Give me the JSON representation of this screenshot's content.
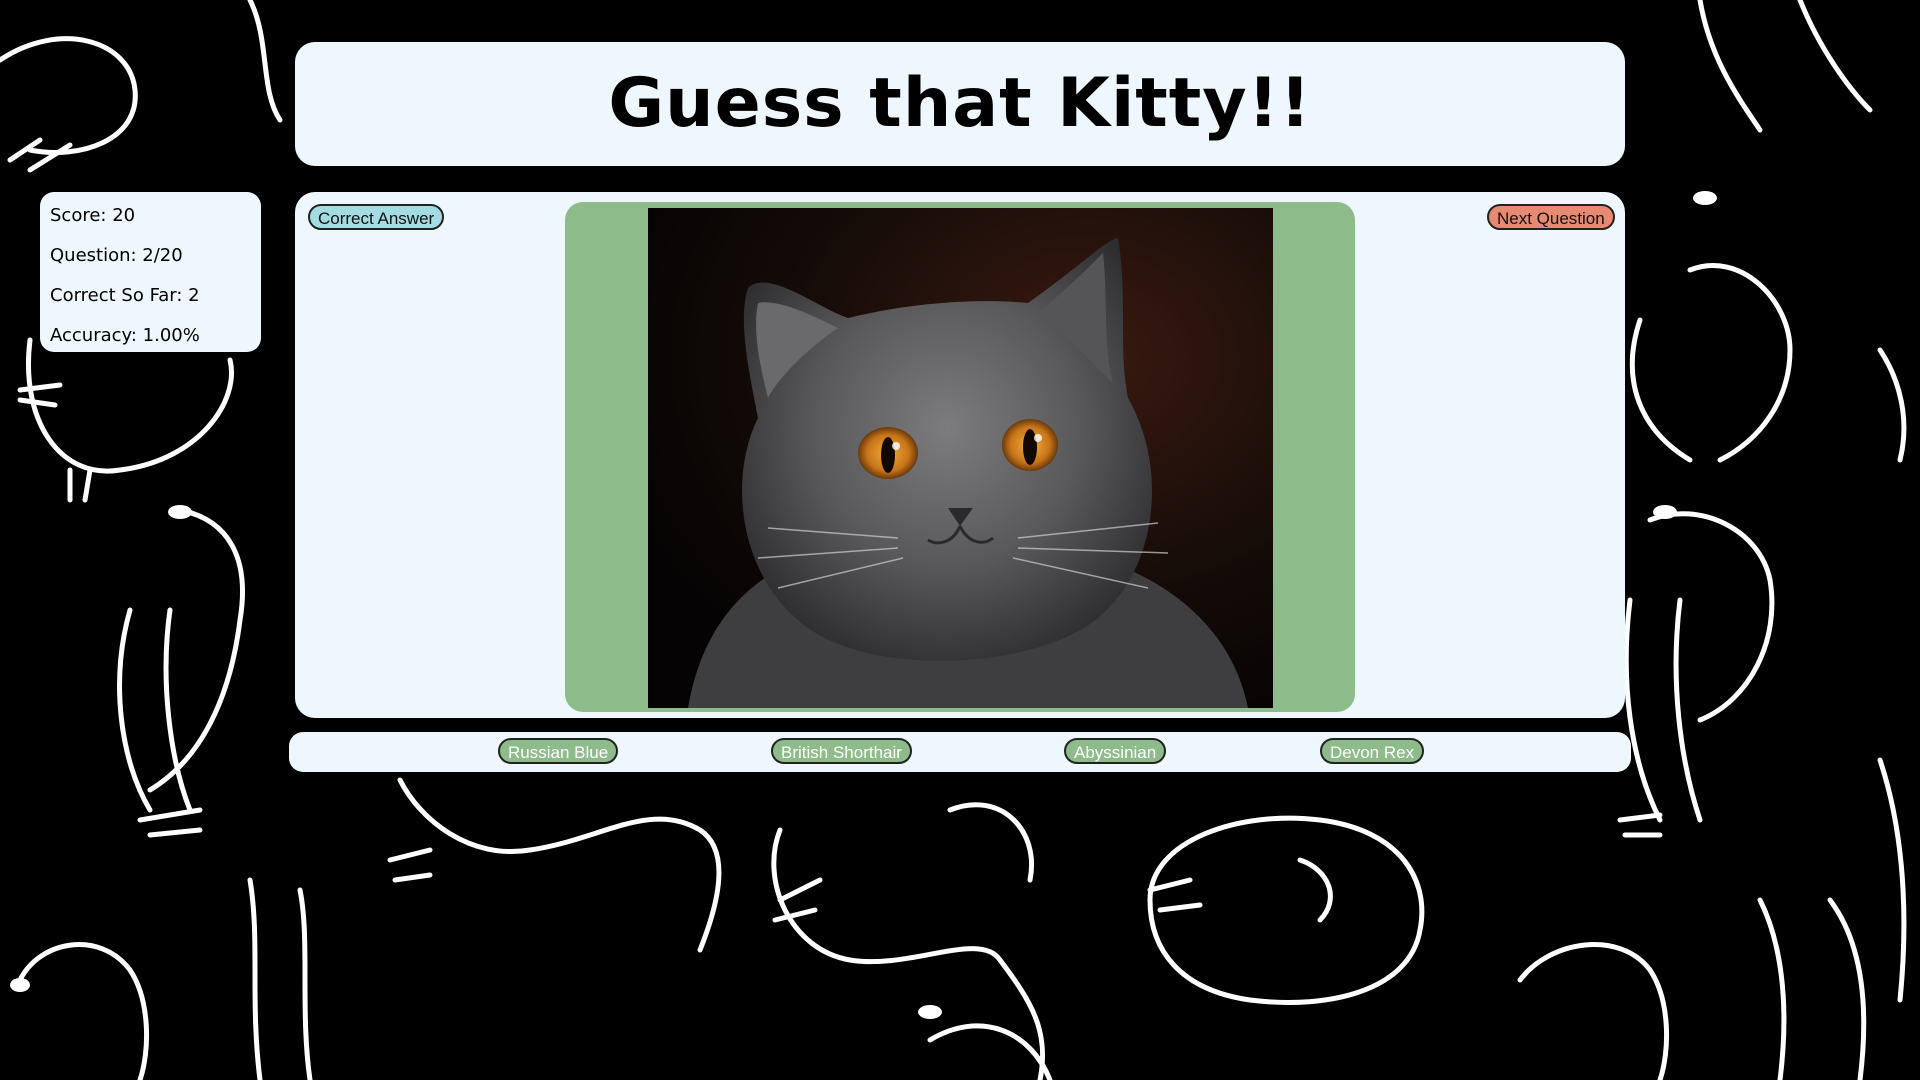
{
  "title": "Guess that Kitty!!",
  "stats": {
    "score": "Score: 20",
    "question": "Question: 2/20",
    "correct": "Correct So Far: 2",
    "accuracy": "Accuracy: 1.00%"
  },
  "buttons": {
    "correct_answer": "Correct Answer",
    "next_question": "Next Question"
  },
  "answers": [
    "Russian Blue",
    "British Shorthair",
    "Abyssinian",
    "Devon Rex"
  ],
  "colors": {
    "panel": "#eef6fe",
    "image_frame": "#8dbb8a",
    "correct_btn": "#a3dce2",
    "next_btn": "#e88a72",
    "answer_btn": "#8dbb8a",
    "background": "#000000"
  }
}
